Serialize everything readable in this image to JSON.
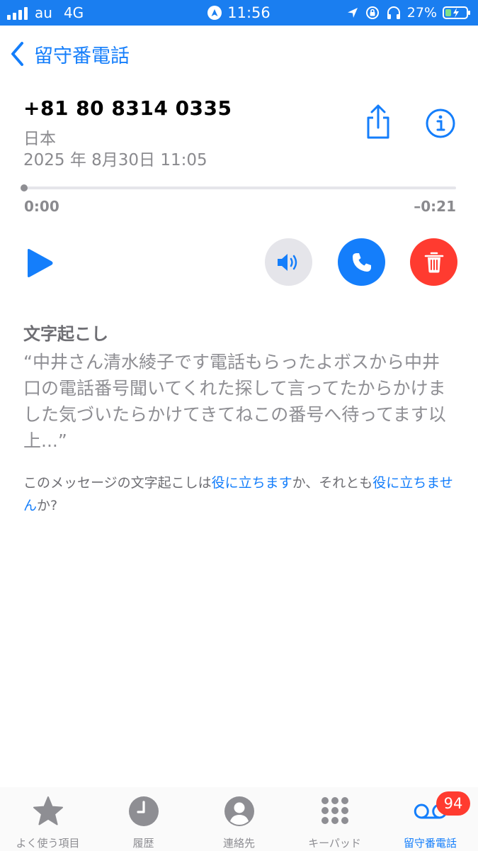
{
  "status_bar": {
    "carrier": "au",
    "network": "4G",
    "time": "11:56",
    "battery_text": "27%",
    "battery_level": 0.27
  },
  "nav": {
    "back_label": "留守番電話"
  },
  "voicemail": {
    "number": "+81 80 8314 0335",
    "country": "日本",
    "date": "2025 年 8月30日 11:05",
    "progress": 0.0,
    "elapsed": "0:00",
    "remaining": "–0:21"
  },
  "transcription": {
    "heading": "文字起こし",
    "text": "“中井さん清水綾子です電話もらったよボスから中井口の電話番号聞いてくれた探して言ってたからかけました気づいたらかけてきてねこの番号へ待ってます以上...”",
    "feedback_prefix": "このメッセージの文字起こしは",
    "feedback_useful": "役に立ちます",
    "feedback_middle": "か、それとも",
    "feedback_not_useful": "役に立ちません",
    "feedback_suffix": "か?"
  },
  "tab_bar": {
    "tabs": [
      {
        "label": "よく使う項目",
        "icon": "star-icon"
      },
      {
        "label": "履歴",
        "icon": "clock-icon"
      },
      {
        "label": "連絡先",
        "icon": "person-icon"
      },
      {
        "label": "キーパッド",
        "icon": "keypad-icon"
      },
      {
        "label": "留守番電話",
        "icon": "voicemail-icon",
        "active": true
      }
    ],
    "voicemail_badge": "94"
  },
  "colors": {
    "accent": "#147efb",
    "status_bar": "#1a7ef0",
    "delete": "#ff3b30",
    "secondary_text": "#8e8e93"
  }
}
